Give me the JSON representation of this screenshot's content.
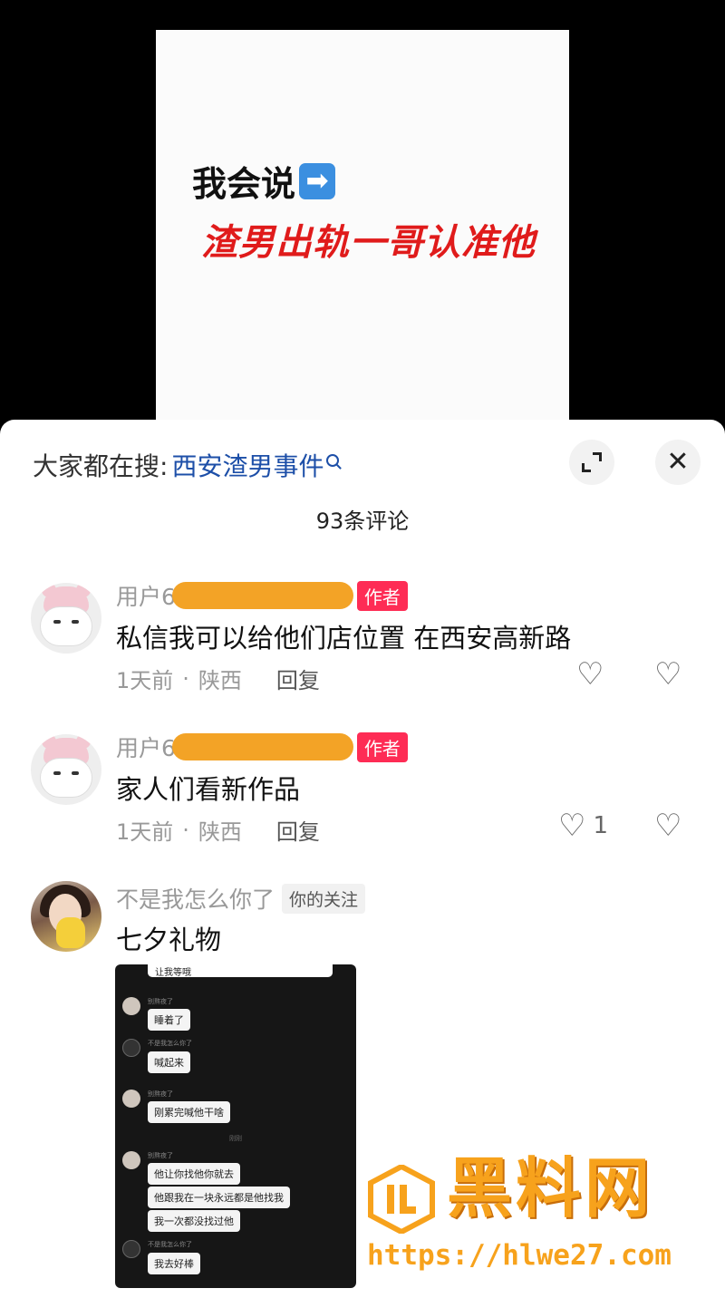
{
  "video": {
    "line1": "我会说",
    "line1_emoji": "➡",
    "line2": "渣男出轨一哥认准他"
  },
  "sheet": {
    "search_prefix": "大家都在搜:",
    "search_term": "西安渣男事件",
    "comment_count": "93条评论"
  },
  "comments": [
    {
      "username": "用户60",
      "badge": "作者",
      "text": "私信我可以给他们店位置 在西安高新路",
      "time": "1天前",
      "location": "陕西",
      "reply": "回复",
      "likes": ""
    },
    {
      "username": "用户60",
      "badge": "作者",
      "text": "家人们看新作品",
      "time": "1天前",
      "location": "陕西",
      "reply": "回复",
      "likes": "1"
    },
    {
      "username": "不是我怎么你了",
      "badge": "你的关注",
      "text": "七夕礼物"
    }
  ],
  "chat_image": {
    "top_message": "让我等哦",
    "messages": [
      {
        "name": "别熬夜了",
        "text": "睡着了"
      },
      {
        "name": "不是我怎么你了",
        "text": "喊起来"
      },
      {
        "name": "别熬夜了",
        "text": "刚累完喊他干啥"
      },
      {
        "name": "别熬夜了",
        "text": "他让你找他你就去"
      },
      {
        "name": "",
        "text": "他跟我在一块永远都是他找我"
      },
      {
        "name": "",
        "text": "我一次都没找过他"
      },
      {
        "name": "不是我怎么你了",
        "text": "我去好棒"
      }
    ],
    "separator": "刚刚"
  },
  "watermark": {
    "title": "黑料网",
    "url": "https://hlwe27.com"
  },
  "colors": {
    "accent_red": "#fe2c55",
    "video_red": "#e01b1b",
    "search_blue": "#1d4fa8",
    "watermark_orange": "#f7a21c"
  },
  "icons": [
    "expand-icon",
    "close-icon",
    "heart-icon",
    "dislike-heart-icon",
    "search-icon"
  ]
}
